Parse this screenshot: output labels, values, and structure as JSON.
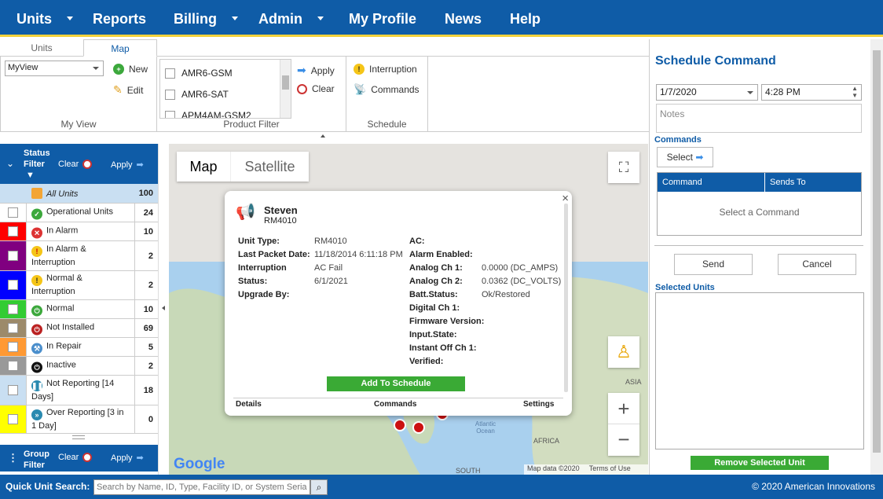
{
  "nav": {
    "units": "Units",
    "reports": "Reports",
    "billing": "Billing",
    "admin": "Admin",
    "profile": "My Profile",
    "news": "News",
    "help": "Help"
  },
  "tabs": {
    "units": "Units",
    "map": "Map"
  },
  "myview": {
    "select": "MyView",
    "new": "New",
    "edit": "Edit",
    "label": "My View"
  },
  "product_filter": {
    "items": [
      "AMR6-GSM",
      "AMR6-SAT",
      "APM4AM-GSM2"
    ],
    "apply": "Apply",
    "clear": "Clear",
    "label": "Product Filter"
  },
  "schedule_grp": {
    "interruption": "Interruption",
    "commands": "Commands",
    "label": "Schedule"
  },
  "status_filter": {
    "title": "Status Filter",
    "clear": "Clear",
    "apply": "Apply",
    "rows": [
      {
        "label": "All Units",
        "count": "100",
        "color": "#c9dff2"
      },
      {
        "label": "Operational Units",
        "count": "24",
        "color": "#ffffff"
      },
      {
        "label": "In Alarm",
        "count": "10",
        "color": "#ff0000"
      },
      {
        "label": "In Alarm & Interruption",
        "count": "2",
        "color": "#800080"
      },
      {
        "label": "Normal & Interruption",
        "count": "2",
        "color": "#0000ff"
      },
      {
        "label": "Normal",
        "count": "10",
        "color": "#33cc33"
      },
      {
        "label": "Not Installed",
        "count": "69",
        "color": "#9c8a6a"
      },
      {
        "label": "In Repair",
        "count": "5",
        "color": "#ff9933"
      },
      {
        "label": "Inactive",
        "count": "2",
        "color": "#999999"
      },
      {
        "label": "Not Reporting [14 Days]",
        "count": "18",
        "color": "#c9dff2"
      },
      {
        "label": "Over Reporting [3 in 1 Day]",
        "count": "0",
        "color": "#ffff00"
      }
    ]
  },
  "group_filter": {
    "title": "Group Filter",
    "clear": "Clear",
    "apply": "Apply"
  },
  "map": {
    "tab_map": "Map",
    "tab_satellite": "Satellite",
    "google": "Google",
    "attribution": "Map data ©2020",
    "terms": "Terms of Use",
    "asia": "ASIA",
    "africa": "AFRICA",
    "atlantic": "Atlantic Ocean",
    "south": "SOUTH"
  },
  "popup": {
    "name": "Steven",
    "model": "RM4010",
    "left": [
      {
        "k": "Unit Type:",
        "v": "RM4010"
      },
      {
        "k": "Last Packet Date:",
        "v": "11/18/2014 6:11:18 PM"
      },
      {
        "k": "Interruption Status:",
        "v": "AC Fail"
      },
      {
        "k": "Upgrade By:",
        "v": "6/1/2021"
      }
    ],
    "right": [
      {
        "k": "AC:",
        "v": ""
      },
      {
        "k": "Alarm Enabled:",
        "v": ""
      },
      {
        "k": "Analog Ch 1:",
        "v": "0.0000 (DC_AMPS)"
      },
      {
        "k": "Analog Ch 2:",
        "v": "0.0362 (DC_VOLTS)"
      },
      {
        "k": "Batt.Status:",
        "v": "Ok/Restored"
      },
      {
        "k": "Digital Ch 1:",
        "v": ""
      },
      {
        "k": "Firmware Version:",
        "v": ""
      },
      {
        "k": "Input.State:",
        "v": ""
      },
      {
        "k": "Instant Off Ch 1:",
        "v": ""
      },
      {
        "k": "Verified:",
        "v": ""
      }
    ],
    "add": "Add To Schedule",
    "details": "Details",
    "commands": "Commands",
    "settings": "Settings"
  },
  "schedule": {
    "title": "Schedule Command",
    "date": "1/7/2020",
    "time": "4:28 PM",
    "notes": "Notes",
    "commands_label": "Commands",
    "select": "Select",
    "col_command": "Command",
    "col_sends": "Sends To",
    "empty": "Select a Command",
    "send": "Send",
    "cancel": "Cancel",
    "selected_units": "Selected Units",
    "remove": "Remove Selected Unit"
  },
  "footer": {
    "label": "Quick Unit Search:",
    "placeholder": "Search by Name, ID, Type, Facility ID, or System Serial",
    "copyright": "© 2020 American Innovations"
  }
}
